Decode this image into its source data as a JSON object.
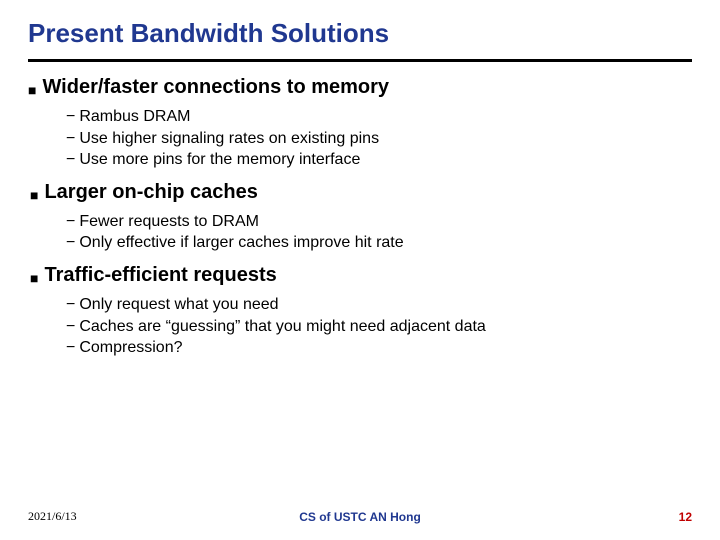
{
  "title": "Present Bandwidth Solutions",
  "topics": [
    {
      "heading": "Wider/faster connections to memory",
      "items": [
        "Rambus DRAM",
        "Use higher signaling rates on existing pins",
        "Use more pins for the memory interface"
      ]
    },
    {
      "heading": "Larger on-chip caches",
      "items": [
        "Fewer requests to DRAM",
        "Only effective if larger caches improve hit rate"
      ]
    },
    {
      "heading": "Traffic-efficient requests",
      "items": [
        "Only request what you need",
        "Caches are “guessing” that you might need adjacent data",
        "Compression?"
      ]
    }
  ],
  "footer": {
    "date": "2021/6/13",
    "center": "CS of USTC AN Hong",
    "page": "12"
  },
  "glyphs": {
    "square": "■",
    "dash": "−"
  }
}
